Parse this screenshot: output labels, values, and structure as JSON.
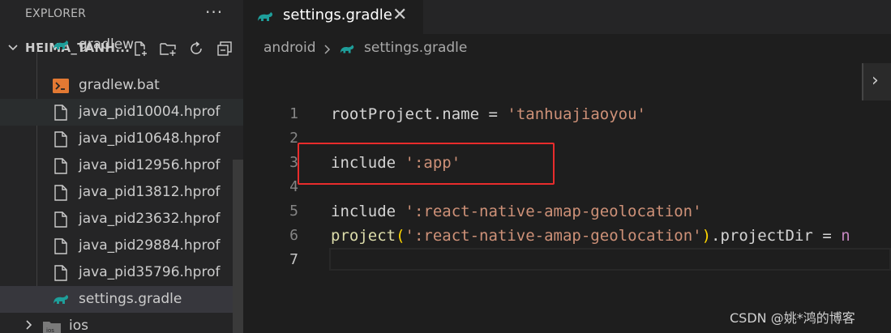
{
  "sidebar": {
    "title": "EXPLORER",
    "more_label": "···",
    "project_name": "HEIMA_TANH...",
    "actions": [
      {
        "icon": "new-file-icon"
      },
      {
        "icon": "new-folder-icon"
      },
      {
        "icon": "refresh-icon"
      },
      {
        "icon": "collapse-all-icon"
      }
    ],
    "files": [
      {
        "label": "gradlew",
        "icon": "gradle-icon"
      },
      {
        "label": "gradlew.bat",
        "icon": "terminal-icon"
      },
      {
        "label": "java_pid10004.hprof",
        "icon": "file-icon"
      },
      {
        "label": "java_pid10648.hprof",
        "icon": "file-icon"
      },
      {
        "label": "java_pid12956.hprof",
        "icon": "file-icon"
      },
      {
        "label": "java_pid13812.hprof",
        "icon": "file-icon"
      },
      {
        "label": "java_pid23632.hprof",
        "icon": "file-icon"
      },
      {
        "label": "java_pid29884.hprof",
        "icon": "file-icon"
      },
      {
        "label": "java_pid35796.hprof",
        "icon": "file-icon"
      },
      {
        "label": "settings.gradle",
        "icon": "gradle-icon"
      }
    ],
    "folder": {
      "label": "ios",
      "icon": "ios-folder-icon"
    }
  },
  "tab": {
    "label": "settings.gradle",
    "close_label": "✕",
    "icon": "gradle-icon"
  },
  "breadcrumb": {
    "folder": "android",
    "file": "settings.gradle"
  },
  "editor": {
    "lines": [
      {
        "num": "1",
        "tokens": [
          {
            "t": "rootProject",
            "c": "c-id"
          },
          {
            "t": ".",
            "c": "c-id"
          },
          {
            "t": "name",
            "c": "c-id"
          },
          {
            "t": " = ",
            "c": "c-id"
          },
          {
            "t": "'tanhuajiaoyou'",
            "c": "c-str"
          }
        ]
      },
      {
        "num": "2",
        "tokens": []
      },
      {
        "num": "3",
        "tokens": [
          {
            "t": "include ",
            "c": "c-id"
          },
          {
            "t": "':app'",
            "c": "c-str"
          }
        ]
      },
      {
        "num": "4",
        "tokens": []
      },
      {
        "num": "5",
        "tokens": [
          {
            "t": "include ",
            "c": "c-id"
          },
          {
            "t": "':react-native-amap-geolocation'",
            "c": "c-str"
          }
        ]
      },
      {
        "num": "6",
        "tokens": [
          {
            "t": "project",
            "c": "c-fn"
          },
          {
            "t": "(",
            "c": "c-paren"
          },
          {
            "t": "':react-native-amap-geolocation'",
            "c": "c-str"
          },
          {
            "t": ")",
            "c": "c-paren"
          },
          {
            "t": ".",
            "c": "c-id"
          },
          {
            "t": "projectDir",
            "c": "c-id"
          },
          {
            "t": " = ",
            "c": "c-id"
          },
          {
            "t": "n",
            "c": "c-kw"
          }
        ]
      },
      {
        "num": "7",
        "tokens": [],
        "current": true
      }
    ],
    "expand_label": "›"
  },
  "watermark": "CSDN @姚*鸿的博客",
  "colors": {
    "accent_red": "#e82c2c",
    "gradle_teal": "#1e9e9a",
    "terminal_orange": "#e37933"
  }
}
